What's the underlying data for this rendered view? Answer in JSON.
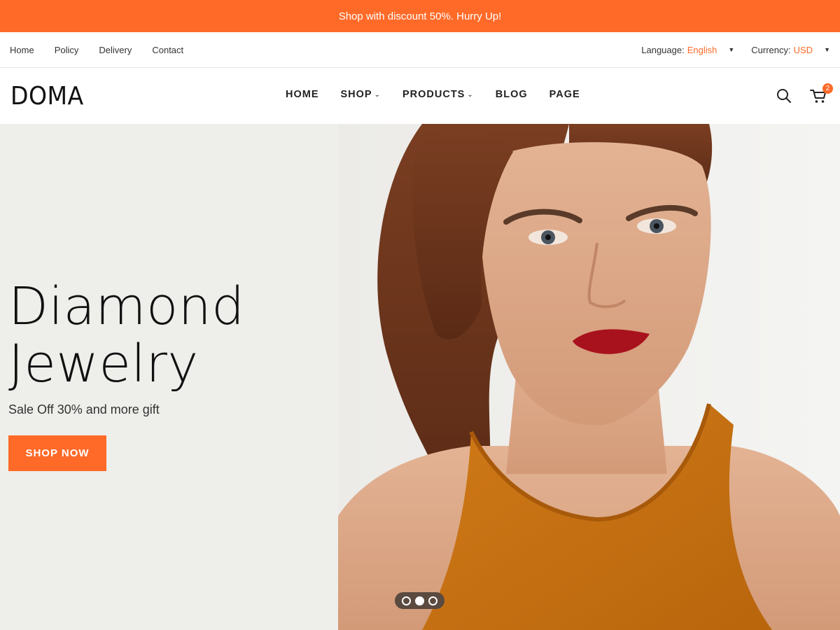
{
  "promo": {
    "text": "Shop with discount 50%. Hurry Up!"
  },
  "topbar": {
    "links": [
      "Home",
      "Policy",
      "Delivery",
      "Contact"
    ],
    "language": {
      "label": "Language:",
      "value": "English"
    },
    "currency": {
      "label": "Currency:",
      "value": "USD"
    }
  },
  "header": {
    "logo": "DOMA",
    "nav": [
      {
        "label": "HOME",
        "has_dropdown": false
      },
      {
        "label": "SHOP",
        "has_dropdown": true
      },
      {
        "label": "PRODUCTS",
        "has_dropdown": true
      },
      {
        "label": "BLOG",
        "has_dropdown": false
      },
      {
        "label": "PAGE",
        "has_dropdown": false
      }
    ],
    "cart_count": "2",
    "icons": [
      "search-icon",
      "cart-icon"
    ]
  },
  "hero": {
    "title_line1": "Diamond",
    "title_line2": "Jewelry",
    "subtitle": "Sale Off 30% and more gift",
    "button_label": "SHOP NOW",
    "slides": 3,
    "active_slide": 2
  },
  "colors": {
    "accent": "#ff6a28",
    "hero_bg": "#eeeeeb",
    "text": "#222222"
  }
}
